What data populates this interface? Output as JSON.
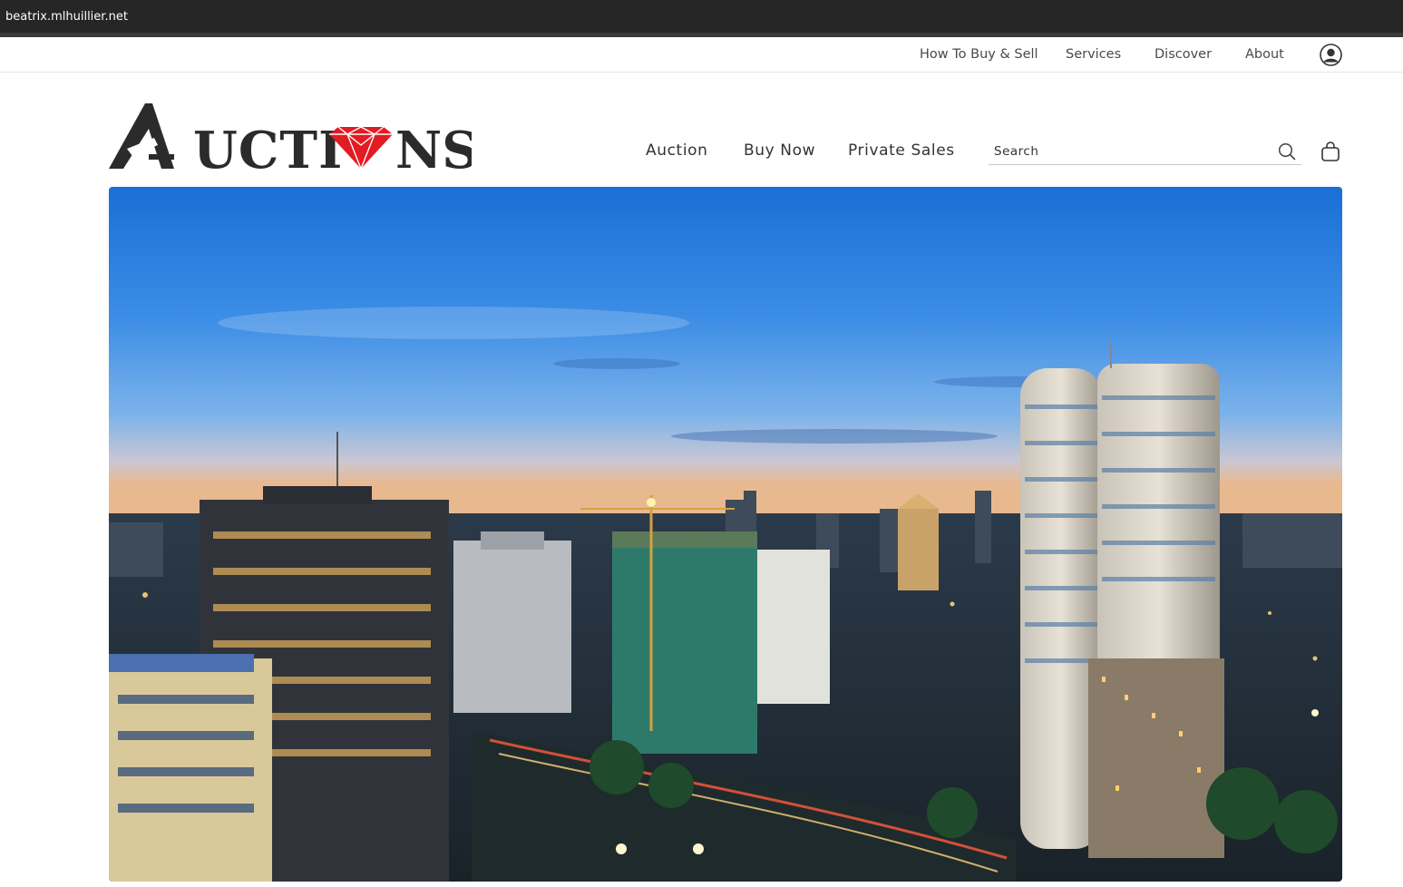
{
  "browser": {
    "url": "beatrix.mlhuillier.net"
  },
  "top_nav": {
    "items": [
      {
        "label": "How To Buy & Sell"
      },
      {
        "label": "Services"
      },
      {
        "label": "Discover"
      },
      {
        "label": "About"
      }
    ],
    "account_icon": "user-circle-icon"
  },
  "logo": {
    "text_left": "UCTI",
    "text_right": "NS"
  },
  "main_nav": {
    "items": [
      {
        "label": "Auction"
      },
      {
        "label": "Buy Now"
      },
      {
        "label": "Private Sales"
      }
    ]
  },
  "search": {
    "placeholder": "Search",
    "icon": "search-icon"
  },
  "cart": {
    "icon": "shopping-bag-icon"
  },
  "hero": {
    "icon": "city-skyline-image"
  },
  "colors": {
    "accent": "#e31b23",
    "dark": "#2b2b2b",
    "browser_bar": "#262626"
  }
}
